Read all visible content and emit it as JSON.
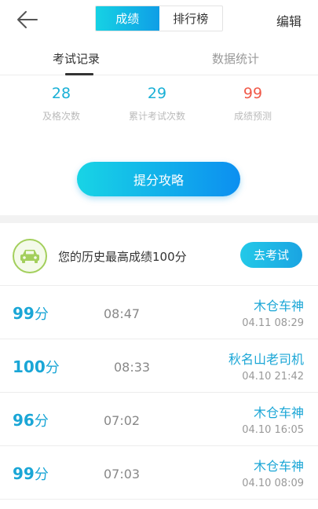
{
  "header": {
    "segments": [
      "成绩",
      "排行榜"
    ],
    "edit_label": "编辑"
  },
  "tabs": [
    "考试记录",
    "数据统计"
  ],
  "stats": [
    {
      "value": "28",
      "label": "及格次数"
    },
    {
      "value": "29",
      "label": "累计考试次数"
    },
    {
      "value": "99",
      "label": "成绩预测"
    }
  ],
  "cta_label": "提分攻略",
  "best": {
    "text": "您的历史最高成绩100分",
    "button_label": "去考试"
  },
  "records": [
    {
      "score": "99",
      "unit": "分",
      "duration": "08:47",
      "name": "木仓车神",
      "time": "04.11  08:29"
    },
    {
      "score": "100",
      "unit": "分",
      "duration": "08:33",
      "name": "秋名山老司机",
      "time": "04.10  21:42"
    },
    {
      "score": "96",
      "unit": "分",
      "duration": "07:02",
      "name": "木仓车神",
      "time": "04.10  16:05"
    },
    {
      "score": "99",
      "unit": "分",
      "duration": "07:03",
      "name": "木仓车神",
      "time": "04.10  08:09"
    }
  ],
  "colors": {
    "accent": "#1aa6d6",
    "predict": "#f05a4a",
    "car_badge": "#a3cf5c"
  },
  "icons": {
    "back": "arrow-left-icon",
    "car": "car-icon"
  }
}
